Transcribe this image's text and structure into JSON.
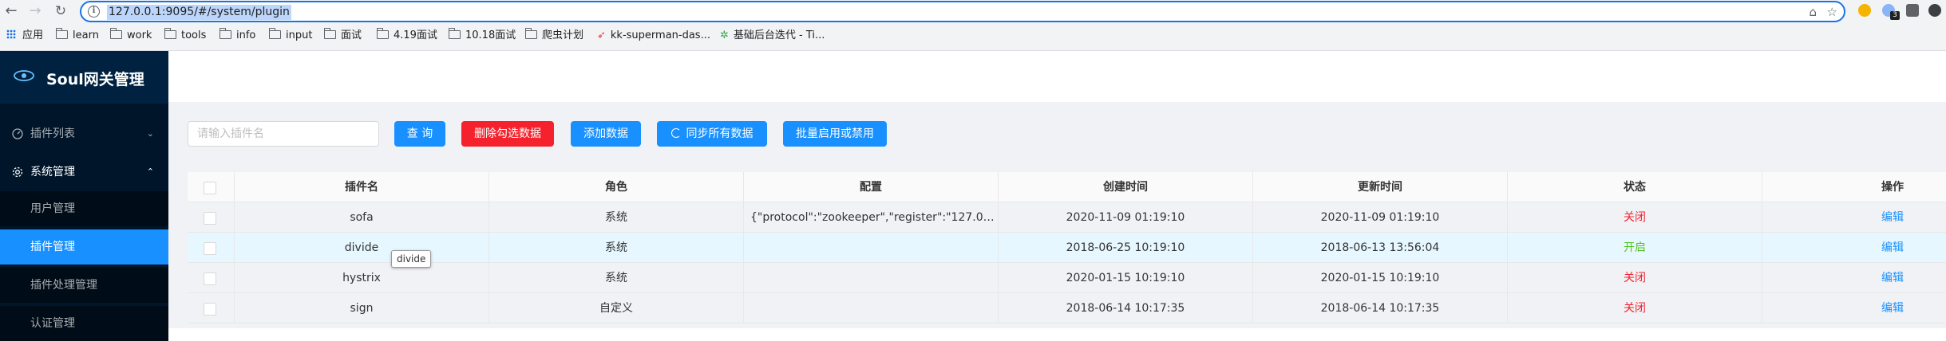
{
  "browser": {
    "url": "127.0.0.1:9095/#/system/plugin",
    "extension_badge": "3",
    "bookmarks": [
      "应用",
      "learn",
      "work",
      "tools",
      "info",
      "input",
      "面试",
      "4.19面试",
      "10.18面试",
      "爬虫计划",
      "kk-superman-das...",
      "基础后台迭代 - Ti..."
    ]
  },
  "sidebar": {
    "title": "Soul网关管理",
    "menus": [
      {
        "label": "插件列表",
        "expanded": false
      },
      {
        "label": "系统管理",
        "expanded": true
      }
    ],
    "sub_items": [
      "用户管理",
      "插件管理",
      "插件处理管理",
      "认证管理"
    ],
    "active_sub_item": "插件管理"
  },
  "toolbar": {
    "search_placeholder": "请输入插件名",
    "search_value": "",
    "query_label": "查 询",
    "delete_label": "删除勾选数据",
    "add_label": "添加数据",
    "sync_label": "同步所有数据",
    "batch_label": "批量启用或禁用"
  },
  "table": {
    "headers": [
      "插件名",
      "角色",
      "配置",
      "创建时间",
      "更新时间",
      "状态",
      "操作"
    ],
    "rows": [
      {
        "name": "sofa",
        "role": "系统",
        "config": "{\"protocol\":\"zookeeper\",\"register\":\"127.0.0....",
        "created": "2020-11-09 01:19:10",
        "updated": "2020-11-09 01:19:10",
        "status": "关闭",
        "action": "编辑"
      },
      {
        "name": "divide",
        "role": "系统",
        "config": "",
        "created": "2018-06-25 10:19:10",
        "updated": "2018-06-13 13:56:04",
        "status": "开启",
        "action": "编辑"
      },
      {
        "name": "hystrix",
        "role": "系统",
        "config": "",
        "created": "2020-01-15 10:19:10",
        "updated": "2020-01-15 10:19:10",
        "status": "关闭",
        "action": "编辑"
      },
      {
        "name": "sign",
        "role": "自定义",
        "config": "",
        "created": "2018-06-14 10:17:35",
        "updated": "2018-06-14 10:17:35",
        "status": "关闭",
        "action": "编辑"
      }
    ]
  },
  "tooltip": {
    "text": "divide"
  },
  "colors": {
    "sidebar_bg": "#001529",
    "primary": "#1890ff",
    "danger": "#f5222d",
    "status_on": "#52c41a",
    "status_off": "#f5222d"
  }
}
